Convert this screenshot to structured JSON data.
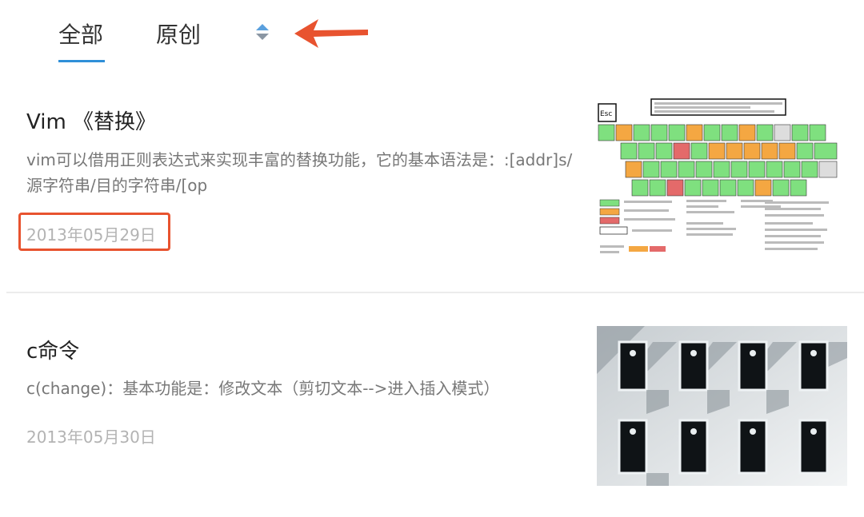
{
  "tabs": [
    {
      "label": "全部",
      "active": true
    },
    {
      "label": "原创",
      "active": false
    }
  ],
  "sort_icon": "sort-up-down-icon",
  "accent_color": "#2f8fd8",
  "annotation_color": "#e8532f",
  "articles": [
    {
      "title": "Vim 《替换》",
      "summary": "vim可以借用正则表达式来实现丰富的替换功能，它的基本语法是：:[addr]s/源字符串/目的字符串/[op",
      "date": "2013年05月29日",
      "thumbnail": {
        "icon": "vim-keyboard-cheatsheet-image",
        "key_label": "Esc"
      }
    },
    {
      "title": "c命令",
      "summary": "c(change)：基本功能是：修改文本（剪切文本-->进入插入模式）",
      "date": "2013年05月30日",
      "thumbnail": {
        "icon": "building-windows-photo"
      }
    }
  ]
}
